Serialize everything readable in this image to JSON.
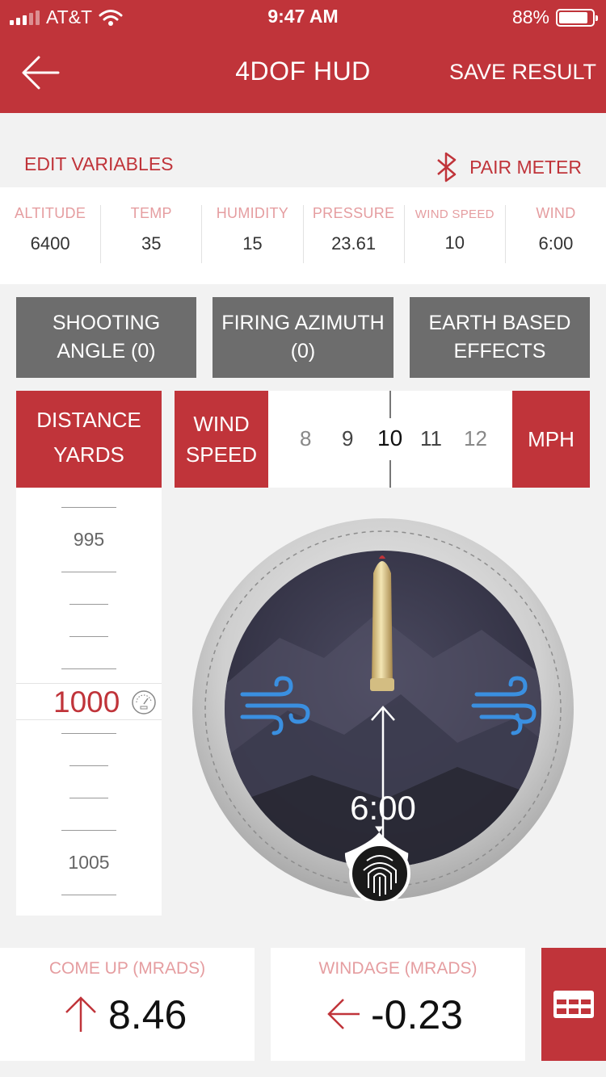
{
  "status_bar": {
    "carrier": "AT&T",
    "time": "9:47 AM",
    "battery_text": "88%",
    "battery_level": 0.88
  },
  "header": {
    "title": "4DOF HUD",
    "save_label": "SAVE RESULT",
    "back_icon": "arrow-left-icon"
  },
  "edit_bar": {
    "edit_label": "EDIT VARIABLES",
    "pair_label": "PAIR METER",
    "pair_icon": "bluetooth-icon"
  },
  "environment": [
    {
      "label": "ALTITUDE",
      "value": "6400"
    },
    {
      "label": "TEMP",
      "value": "35"
    },
    {
      "label": "HUMIDITY",
      "value": "15"
    },
    {
      "label": "PRESSURE",
      "value": "23.61"
    },
    {
      "label": "WIND SPEED",
      "value": "10"
    },
    {
      "label": "WIND",
      "value": "6:00"
    }
  ],
  "options": {
    "shooting_angle": {
      "line1": "SHOOTING",
      "line2": "ANGLE (0)"
    },
    "firing_azimuth": {
      "line1": "FIRING AZIMUTH",
      "line2": "(0)"
    },
    "earth_effects": {
      "line1": "EARTH BASED",
      "line2": "EFFECTS"
    }
  },
  "distance": {
    "label_line1": "DISTANCE",
    "label_line2": "YARDS",
    "prev_value": "995",
    "current_value": "1000",
    "next_value": "1005"
  },
  "wind": {
    "label_line1": "WIND",
    "label_line2": "SPEED",
    "options": [
      "8",
      "9",
      "10",
      "11",
      "12"
    ],
    "selected": "10",
    "unit": "MPH"
  },
  "dial": {
    "clock_value": "6:00",
    "icons": [
      "bullet-icon",
      "wind-icon",
      "fingerprint-icon"
    ]
  },
  "results": {
    "come_up_label": "COME UP (MRADS)",
    "come_up_value": "8.46",
    "windage_label": "WINDAGE (MRADS)",
    "windage_value": "-0.23",
    "table_icon": "table-icon"
  },
  "colors": {
    "brand_red": "#c0343a",
    "button_grey": "#6d6d6d",
    "label_pink": "#e59da0",
    "wind_blue": "#3a8fe0"
  }
}
